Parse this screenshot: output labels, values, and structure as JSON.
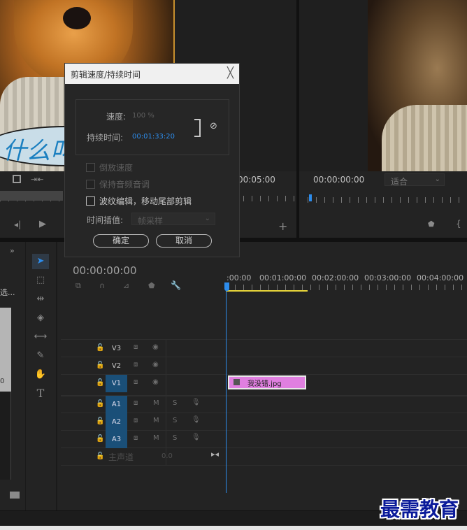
{
  "dialog": {
    "title": "剪辑速度/持续时间",
    "close": "╳",
    "speed_label": "速度:",
    "speed_value": "100 %",
    "duration_label": "持续时间:",
    "duration_value": "00:01:33:20",
    "reverse_label": "倒放速度",
    "maintain_audio_label": "保持音频音调",
    "ripple_label": "波纹编辑，移动尾部剪辑",
    "interp_label": "时间插值:",
    "interp_value": "帧采样",
    "ok": "确定",
    "cancel": "取消"
  },
  "source_monitor": {
    "bubble_text": "什么叫",
    "time_right": "00:05:00"
  },
  "program_monitor": {
    "timecode": "00:00:00:00",
    "fit": "适合"
  },
  "project": {
    "left_label": "选...",
    "left_num": "0"
  },
  "timeline": {
    "timecode": "00:00:00:00",
    "ruler": [
      ":00:00",
      "00:01:00:00",
      "00:02:00:00",
      "00:03:00:00",
      "00:04:00:00"
    ],
    "tracks": [
      {
        "name": "V3",
        "active": false
      },
      {
        "name": "V2",
        "active": false
      },
      {
        "name": "V1",
        "active": true
      },
      {
        "name": "A1",
        "active": true
      },
      {
        "name": "A2",
        "active": true
      },
      {
        "name": "A3",
        "active": true
      }
    ],
    "track_m": "M",
    "track_s": "S",
    "master_label": "主声道",
    "master_value": "0.0",
    "clip_name": "我没错.jpg"
  },
  "watermark": "最需教育",
  "colors": {
    "accent_blue": "#2d8ceb",
    "clip_pink": "#e07fe0",
    "work_area_yellow": "#e8d53a"
  }
}
